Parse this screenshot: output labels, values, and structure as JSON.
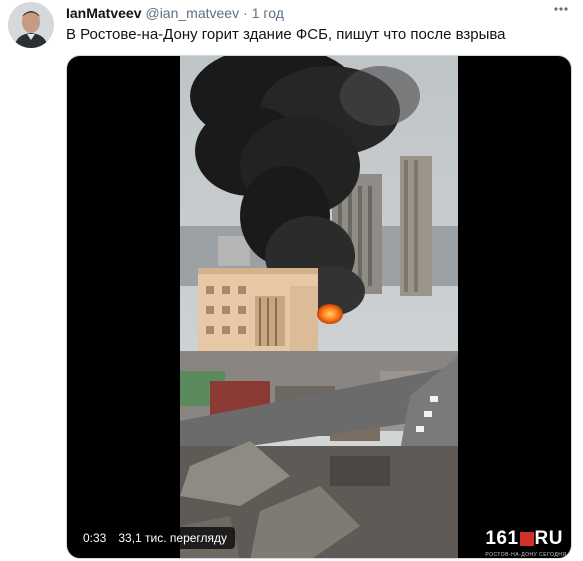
{
  "tweet": {
    "author_name": "IanMatveev",
    "author_handle": "@ian_matveev",
    "separator": "·",
    "time": "1 год",
    "text": "В Ростове-на-Дону горит здание ФСБ, пишут что после взрыва",
    "more_icon": "more-dots-icon"
  },
  "video": {
    "duration": "0:33",
    "views": "33,1 тис. перегляду",
    "watermark_num": "161",
    "watermark_ru": "RU",
    "watermark_sub": "РОСТОВ-НА-ДОНУ СЕГОДНЯ"
  },
  "colors": {
    "smoke": "#1a1a1a",
    "fire": "#ff7a1a",
    "building": "#e6c8a6",
    "sky": "#c9cdd0"
  }
}
